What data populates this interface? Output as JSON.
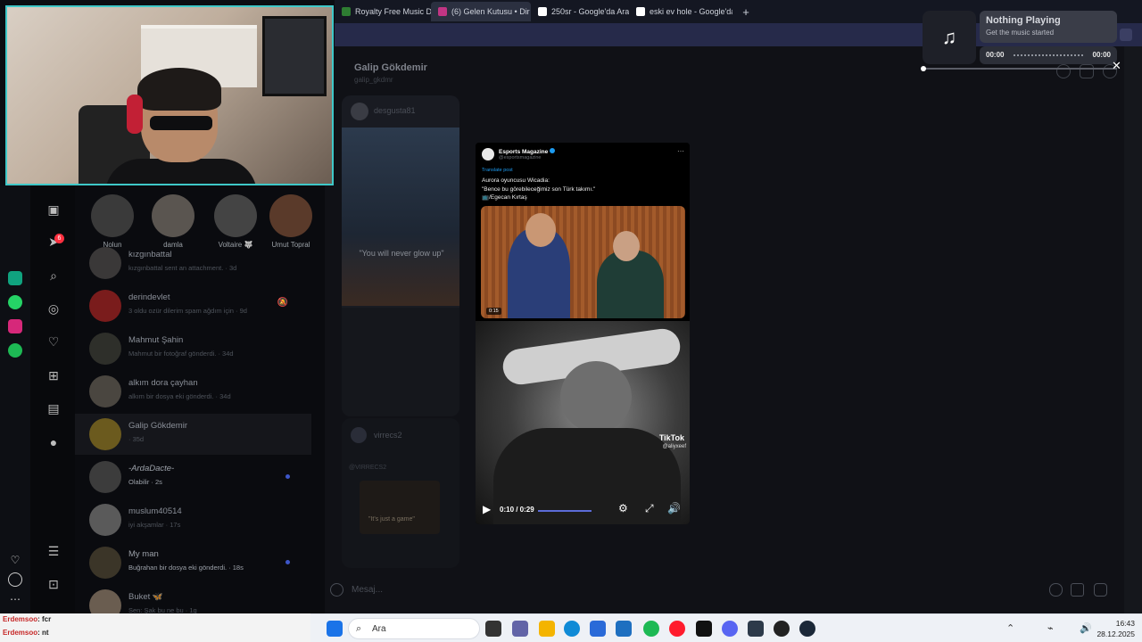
{
  "browser": {
    "tabs": [
      {
        "label": "Royalty Free Music Downl",
        "favicon_color": "#2e7d32"
      },
      {
        "label": "(6) Gelen Kutusu • Dir",
        "favicon_color": "#c13584",
        "active": true
      },
      {
        "label": "250sr - Google'da Ara",
        "favicon_color": "#ffffff"
      },
      {
        "label": "eski ev hole - Google'da A",
        "favicon_color": "#ffffff"
      }
    ],
    "new_tab_label": "+"
  },
  "music_widget": {
    "icon": "music-note-icon",
    "title": "Nothing Playing",
    "subtitle": "Get the music started",
    "time_elapsed": "00:00",
    "time_total": "00:00"
  },
  "webcam": {
    "caption": ""
  },
  "stories": [
    {
      "name": "Nolun"
    },
    {
      "name": "damla"
    },
    {
      "name": "Voltaire 🐺"
    },
    {
      "name": "Umut Topral"
    }
  ],
  "conversations": [
    {
      "name": "kızgınbattal",
      "preview": "kızgınbattal sent an attachment. · 3d"
    },
    {
      "name": "derindevlet",
      "preview": "3 oldu ozür dilerim spam ağdım için · 9d",
      "muted": true
    },
    {
      "name": "Mahmut Şahin",
      "preview": "Mahmut bir fotoğraf gönderdi. · 34d"
    },
    {
      "name": "alkım dora çayhan",
      "preview": "alkım bir dosya eki gönderdi. · 34d"
    },
    {
      "name": "Galip Gökdemir",
      "preview": "· 35d",
      "active": true
    },
    {
      "name": "-ArdaDacte-",
      "preview": "Olabilir · 2s",
      "unread": true
    },
    {
      "name": "muslum40514",
      "preview": "iyi akşamlar · 17s"
    },
    {
      "name": "My man",
      "preview": "Buğrahan bir dosya eki gönderdi. · 18s",
      "unread": true
    },
    {
      "name": "Buket 🦋",
      "preview": "Sen: Şak bu ne bu · 1g"
    }
  ],
  "rail": {
    "badge_count": "6"
  },
  "chat": {
    "name": "Galip Gökdemir",
    "username": "galip_gkdmr",
    "shared_user_1": "desgusta81",
    "shared_caption_1": "\"You will never glow up\"",
    "shared_user_2": "virrecs2",
    "shared_caption_2": "\"It's just a game\"",
    "shared_handle_2": "@VIRRECS2",
    "composer_placeholder": "Mesaj..."
  },
  "embed": {
    "account": "Esports Magazine",
    "handle": "@esportsmagazine",
    "translate": "Translate post",
    "text_line1": "Aurora oyuncusu Wicadia:",
    "text_line2": "\"Bence bu görebileceğimiz son Türk takımı.\"",
    "text_line3": "📺/Egecan Kırtaş",
    "photo_time": "0:15",
    "tiktok_brand": "TikTok",
    "tiktok_user": "@aliyxeef",
    "video_time": "0:10 / 0:29"
  },
  "stream_chat": [
    {
      "user": "Erdemsoo",
      "message": ": fcr"
    },
    {
      "user": "Erdemsoo",
      "message": ": nt"
    }
  ],
  "taskbar": {
    "search_label": "Ara",
    "time": "16:43",
    "date": "28.12.2025"
  }
}
